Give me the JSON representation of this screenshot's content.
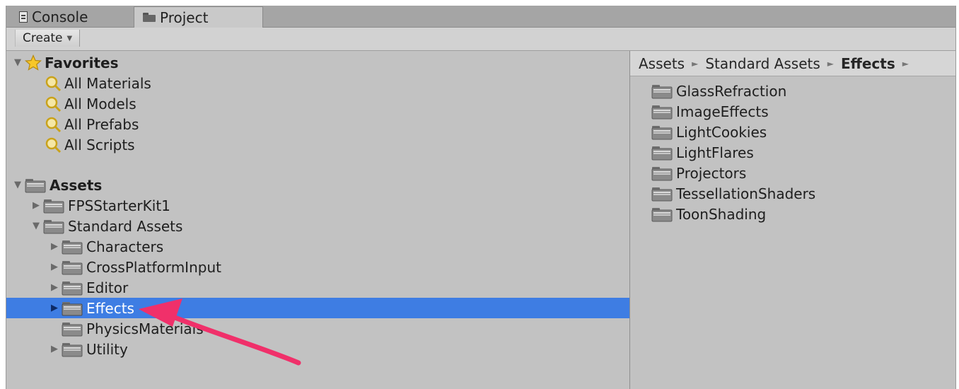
{
  "tabs": {
    "console_label": "Console",
    "project_label": "Project"
  },
  "toolbar": {
    "create_label": "Create",
    "create_caret": "▼"
  },
  "favorites": {
    "label": "Favorites",
    "items": [
      {
        "label": "All Materials",
        "icon": "search-icon"
      },
      {
        "label": "All Models",
        "icon": "search-icon"
      },
      {
        "label": "All Prefabs",
        "icon": "search-icon"
      },
      {
        "label": "All Scripts",
        "icon": "search-icon"
      }
    ]
  },
  "assets": {
    "label": "Assets",
    "children": [
      {
        "label": "FPSStarterKit1",
        "expanded": false
      },
      {
        "label": "Standard Assets",
        "expanded": true
      },
      {
        "label": "Characters",
        "expanded": false
      },
      {
        "label": "CrossPlatformInput",
        "expanded": false
      },
      {
        "label": "Editor",
        "expanded": false
      },
      {
        "label": "Effects",
        "expanded": false,
        "selected": true
      },
      {
        "label": "PhysicsMaterials",
        "expanded": false
      },
      {
        "label": "Utility",
        "expanded": false
      }
    ]
  },
  "breadcrumb": {
    "items": [
      "Assets",
      "Standard Assets",
      "Effects"
    ],
    "separator": "►"
  },
  "folder_contents": [
    "GlassRefraction",
    "ImageEffects",
    "LightCookies",
    "LightFlares",
    "Projectors",
    "TessellationShaders",
    "ToonShading"
  ],
  "colors": {
    "selection": "#3e7de3",
    "annotation_arrow": "#f0306a",
    "panel_bg": "#c2c2c2"
  }
}
